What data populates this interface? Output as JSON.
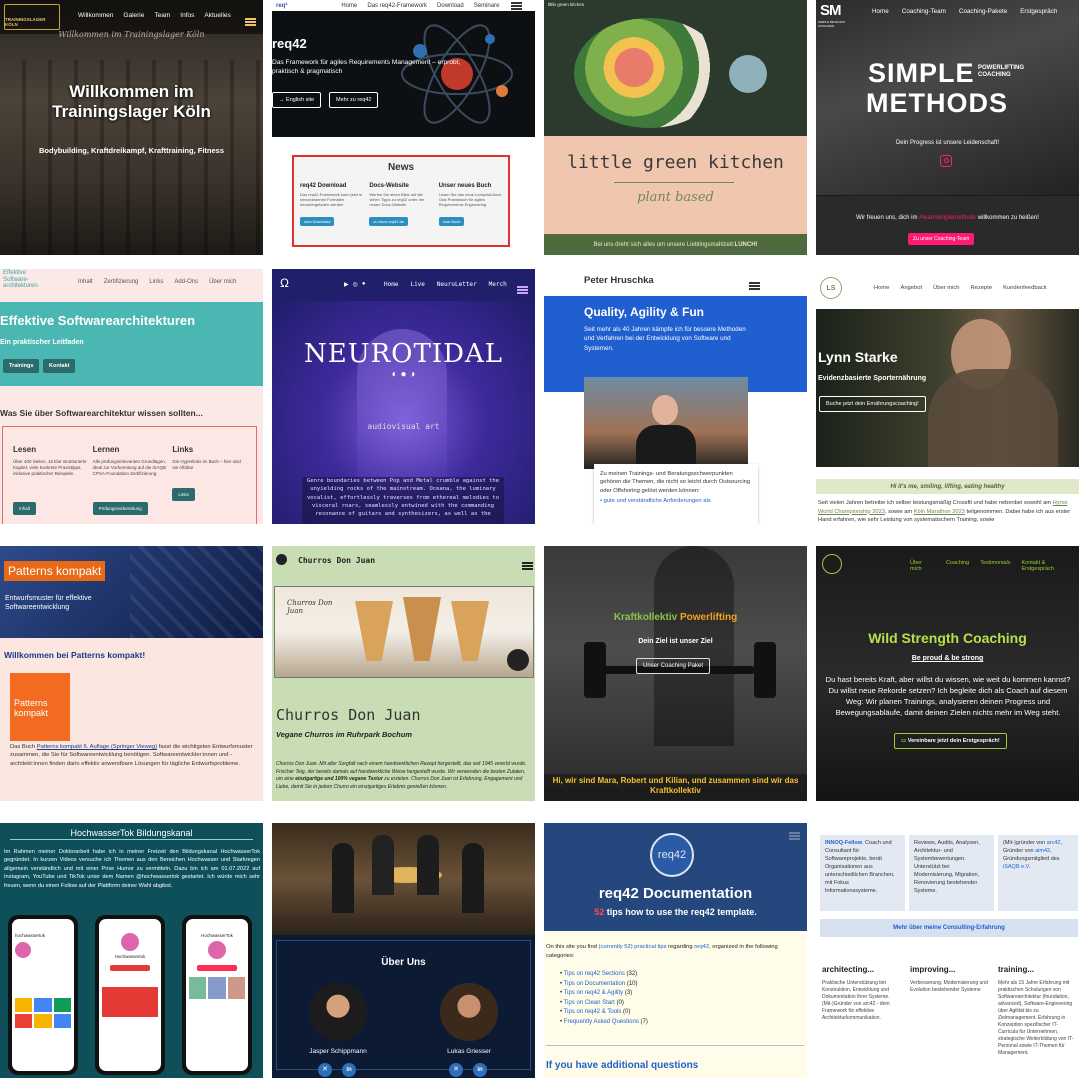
{
  "t1": {
    "logo": "TRAININGSLAGER KÖLN",
    "nav": [
      "Willkommen",
      "Galerie",
      "Team",
      "Infos",
      "Aktuelles"
    ],
    "banner": "Willkommen im Trainingslager Köln",
    "heading": "Willkommen im Trainingslager Köln",
    "sub": "Bodybuilding, Kraftdreikampf, Krafttraining, Fitness"
  },
  "t2": {
    "nav": [
      "Home",
      "Das req42-Framework",
      "Download",
      "Seminare"
    ],
    "title": "req42",
    "desc": "Das Framework für agiles Requirements Management – erprobt, praktisch & pragmatisch",
    "btn1": "→ English site",
    "btn2": "Mehr zu req42",
    "news_title": "News",
    "cols": [
      {
        "title": "req42 Download",
        "text": "Das req42-Framework kann jetzt in verschiedenen Formaten heruntergeladen werden",
        "btn": "zum Download"
      },
      {
        "title": "Docs-Website",
        "text": "Werfen Sie einen Blick auf die vielen Tipps zu req42 unter der neuen Docs-Website",
        "btn": "zu docs.req42.de"
      },
      {
        "title": "Unser neues Buch",
        "text": "Lesen Sie das neue Lernpfad-Buch 'Das Praxisbuch für agiles Requirements Engineering'",
        "btn": "zum Buch"
      }
    ]
  },
  "t3": {
    "logo": "little green kitchen",
    "title": "little green kitchen",
    "sub": "plant based",
    "footer_text": "Bei uns dreht sich alles um unsere Lieblingsmahlzeit: ",
    "footer_bold": "LUNCH!"
  },
  "t4": {
    "logo_letters": "SM",
    "logo_sub": "SIMPLE METHODS COACHING",
    "nav": [
      "Home",
      "Coaching-Team",
      "Coaching-Pakete",
      "Erstgespräch"
    ],
    "brand1": "SIMPLE",
    "brand_tag": "POWERLIFTING COACHING",
    "brand2": "METHODS",
    "tag": "Dein Progress ist unsere Leidenschaft!",
    "welcome_a": "Wir freuen uns, dich im ",
    "welcome_link": "#teamsimplemethods",
    "welcome_b": " willkommen zu heißen!",
    "btn": "Zu unser Coaching-Team"
  },
  "t5": {
    "logo1": "Effektive",
    "logo2": "Software-",
    "logo3": "architekturen",
    "nav": [
      "Inhalt",
      "Zertifizierung",
      "Links",
      "Add-Ons",
      "Über mich"
    ],
    "title": "Effektive Softwarearchitekturen",
    "sub": "Ein praktischer Leitfaden",
    "btn1": "Trainings",
    "btn2": "Kontakt",
    "question": "Was Sie über Softwarearchitektur wissen sollten...",
    "cols": [
      {
        "title": "Lesen",
        "text": "Über 400 Seiten, 16 klar strukturierte Kapitel, viele konkrete Praxistipps, inklusive praktischer Beispiele.",
        "btn": "Inhalt"
      },
      {
        "title": "Lernen",
        "text": "Alle prüfungsrelevanten Grundlagen, ideal zur Vorbereitung auf die iSAQB CPSA-Foundation Zertifizierung.",
        "btn": "Prüfungsvorbereitung"
      },
      {
        "title": "Links",
        "text": "Die Hyperlinks im Buch – hier sind sie Alfabar",
        "btn": "Links"
      }
    ]
  },
  "t6": {
    "nav": [
      "Home",
      "Live",
      "NeuroLetter",
      "Merch"
    ],
    "title": "NEUROTIDAL",
    "sub": "audiovisual art",
    "text": "Genre boundaries between Pop and Metal crumble against the unyielding rocks of the mainstream. Oceana, the luminary vocalist, effortlessly traverses from ethereal melodies to visceral roars, seamlessly entwined with the commanding resonance of guitars and synthesizers, as well as the"
  },
  "t7": {
    "name": "Peter Hruschka",
    "title": "Quality, Agility & Fun",
    "text": "Seit mehr als 40 Jahren kämpfe ich für bessere Methoden und Verfahren bei der Entwicklung von Software und Systemen.",
    "card_text": "Zu meinen Trainings- und Beratungsschwerpunkten gehören die Themen, die nicht so leicht durch Outsourcing oder Offshoring gelöst werden können:",
    "bullet": "gute und verständliche Anforderungen als"
  },
  "t8": {
    "logo": "LS",
    "nav": [
      "Home",
      "Angebot",
      "Über mich",
      "Rezepte",
      "Kundenfeedback"
    ],
    "name": "Lynn Starke",
    "sub": "Evidenzbasierte Sporternährung",
    "btn": "Buche jetzt dein Ernährungscoaching!",
    "strip": "Hi it's me, smiling, lifting, eating healthy",
    "text_a": "Seit vielen Jahren betreibe ich selber leistungsmäßig Crossfit und habe nebenbei sowohl am ",
    "link1": "Hyrox World Championship 2023",
    "text_b": ", sowie am ",
    "link2": "Köln Marathon 2023",
    "text_c": " teilgenommen. Dabei habe ich aus erster Hand erfahren, wie sehr Leistung von systematischem Training, sowie"
  },
  "t9": {
    "badge": "Patterns kompakt",
    "sub1": "Entwurfsmuster für effektive",
    "sub2": "Softwareentwicklung",
    "welcome": "Willkommen bei Patterns kompakt!",
    "book1": "Patterns",
    "book2": "kompakt",
    "text_a": "Das Buch ",
    "link": "Patterns kompakt 6. Auflage (Springer Vieweg)",
    "text_b": " fasst die wichtigsten Entwurfsmuster zusammen, die Sie für Softwareentwicklung benötigen. Softwareentwickler:innen und -architekt:innen finden darin effektiv anwendbare Lösungen für tägliche Entwurfsprobleme."
  },
  "t10": {
    "logo": "Churros Don Juan",
    "title": "Churros Don Juan",
    "sub": "Vegane Churros im Ruhrpark Bochum",
    "sign": "Churros Don Juan",
    "text_a": "Churros Don Juan. Mit aller Sorgfalt nach einem handwerklichen Rezept hergestellt, das seit 1945 vererbt wurde. Frischer Teig, der bereits damals auf handwerkliche Weise hergestellt wurde. Wir verwenden die besten Zutaten, um eine ",
    "text_bold": "einzigartige und 100% vegane Textur",
    "text_b": " zu erzielen. Churros Don Juan ist Erfahrung, Engagement und Liebe, damit Sie in jedem Churro ein einzigartiges Erlebnis genießen können."
  },
  "t11": {
    "brand1": "Kraftkollektiv",
    "brand2": "Powerlifting",
    "tag": "Dein Ziel ist unser Ziel",
    "btn": "Unser Coaching Paket",
    "footer": "Hi, wir sind Mara, Robert und Kilian, und zusammen sind wir das Kraftkollektiv"
  },
  "t12": {
    "nav": [
      "Über mich",
      "Coaching",
      "Testimonials",
      "Kontakt & Erstgespräch"
    ],
    "title": "Wild Strength Coaching",
    "tag": "Be proud & be strong",
    "text": "Du hast bereits Kraft, aber willst du wissen, wie weit du kommen kannst? Du willst neue Rekorde setzen? Ich begleite dich als Coach auf diesem Weg: Wir planen Trainings, analysieren deinen Progress und Bewegungsabläufe, damit deinen Zielen nichts mehr im Weg steht.",
    "btn": "Vereinbare jetzt dein Erstgespräch!"
  },
  "t13": {
    "title": "HochwasserTok Bildungskanal",
    "text": "Im Rahmen meiner Doktorarbeit habe ich in meiner Freizeit den Bildungskanal HochwasserTok gegründet. In kurzen Videos versuche ich Themen aus den Bereichen Hochwasser und Starkregen allgemein verständlich und mit einer Prise Humor zu vermitteln. Dazu bin ich am 01.07.2022 auf Instagram, YouTube und TikTok unter dem Namen @hochwassertok gestartet. Ich würde mich sehr freuen, wenn du einen Follow auf der Plattform deiner Wahl abgibst.",
    "p1": "hochwassertok",
    "p2": "Hochwassertok",
    "p3": "HochwasserTok"
  },
  "t14": {
    "title": "Über Uns",
    "p1": "Jasper Schippmann",
    "p2": "Lukas Griesser"
  },
  "t15": {
    "logo": "req42",
    "title": "req42 Documentation",
    "sub_num": "52",
    "sub_rest": " tips how to use the req42 template.",
    "intro_a": "On this site you find ",
    "intro_link1": "(currently 52) practical tips",
    "intro_b": " regarding ",
    "intro_link2": "req42",
    "intro_c": ", organized in the following categories:",
    "items": [
      {
        "label": "Tips on req42 Sections",
        "count": "(32)"
      },
      {
        "label": "Tips on Documentation",
        "count": "(10)"
      },
      {
        "label": "Tips on req42 & Agility",
        "count": "(3)"
      },
      {
        "label": "Tips on Clean Start",
        "count": "(0)"
      },
      {
        "label": "Tips on req42 & Tools",
        "count": "(0)"
      },
      {
        "label": "Frequently Asked Questions",
        "count": "(7)"
      }
    ],
    "more": "If you have additional questions"
  },
  "t16": {
    "col1_link": "INNOQ-Fellow",
    "col1_text": ". Coach und Consultant für Softwareprojekte, berät Organisationen aus unterschiedlichen Branchen, mit Fokus Informationssysteme.",
    "col2_text": "Reviews, Audits, Analysen, Architektur- und Systembewertungen. Unterstützt bei Modernisierung, Migration, Renovierung bestehender Systeme.",
    "col3_a": "(Mit-)gründer von ",
    "col3_link1": "arc42",
    "col3_b": ", Gründer von ",
    "col3_link2": "aim42",
    "col3_c": ", Gründungsmitglied des ",
    "col3_link3": "iSAQB e.V.",
    "btn": "Mehr über meine Consulting-Erfahrung",
    "cols": [
      {
        "title": "architecting...",
        "text": "Praktische Unterstützung bei Konstruktion, Entwicklung und Dokumentation Ihrer Systeme. (Mit-)Gründer von arc42 - dem Framework für effektive Architekturkommunikation."
      },
      {
        "title": "improving...",
        "text": "Verbesserung, Modernisierung und Evolution bestehender Systeme"
      },
      {
        "title": "training...",
        "text": "Mehr als 15 Jahre Erfahrung mit praktischen Schulungen von Softwarearchitektur (foundation, advanced), Software-Engineering über Agilität bis zu Zielmanagement. Erfahrung in Konzeption spezifischer IT-Curricula für Unternehmen, strategische Weiterbildung von IT-Personal sowie IT-Themen für Management."
      }
    ]
  }
}
